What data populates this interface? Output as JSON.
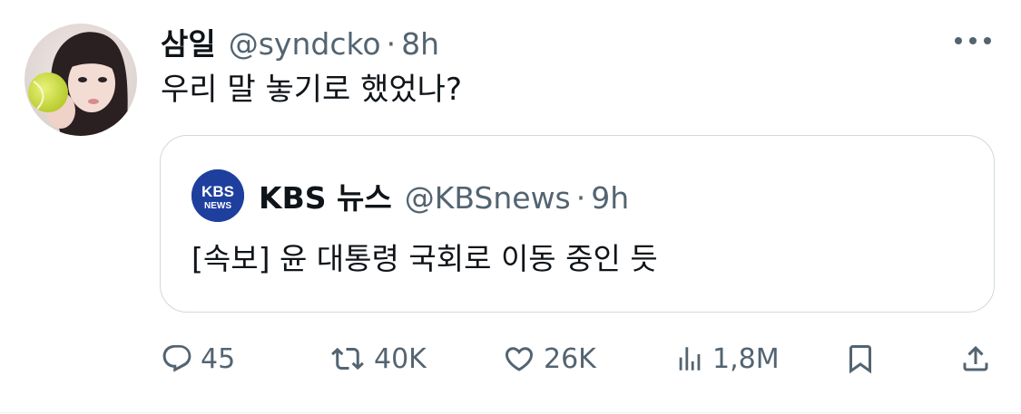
{
  "tweet": {
    "display_name": "삼일",
    "handle": "@syndcko",
    "separator": "·",
    "time": "8h",
    "text": "우리 말 놓기로 했었나?"
  },
  "quote": {
    "display_name": "KBS 뉴스",
    "handle": "@KBSnews",
    "separator": "·",
    "time": "9h",
    "text": "[속보] 윤 대통령 국회로 이동 중인 듯",
    "avatar_logo_text": "KBS NEWS",
    "avatar_color": "#1e3f9e"
  },
  "actions": {
    "reply_count": "45",
    "retweet_count": "40K",
    "like_count": "26K",
    "views_count": "1,8M",
    "icons": [
      "reply-icon",
      "retweet-icon",
      "like-icon",
      "views-icon",
      "bookmark-icon",
      "share-icon"
    ]
  },
  "colors": {
    "text_primary": "#0f1419",
    "text_secondary": "#536471",
    "border": "#cfd9de"
  }
}
